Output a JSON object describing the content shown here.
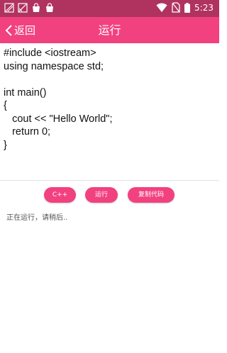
{
  "status_bar": {
    "time": "5:23",
    "left_icons": [
      "swatch-icon",
      "picture-icon",
      "bag-icon",
      "bag-icon"
    ],
    "right_icons": [
      "wifi-icon",
      "no-sim-icon",
      "battery-icon"
    ]
  },
  "app_bar": {
    "back_label": "返回",
    "title": "运行",
    "background": "#f2417f"
  },
  "code": {
    "text": "#include <iostream>\nusing namespace std;\n\nint main()\n{\n   cout << \"Hello World\";\n   return 0;\n}"
  },
  "actions": {
    "cpp_label": "C++",
    "run_label": "运行",
    "copy_label": "复制代码"
  },
  "output": {
    "text": "正在运行，请稍后.."
  }
}
